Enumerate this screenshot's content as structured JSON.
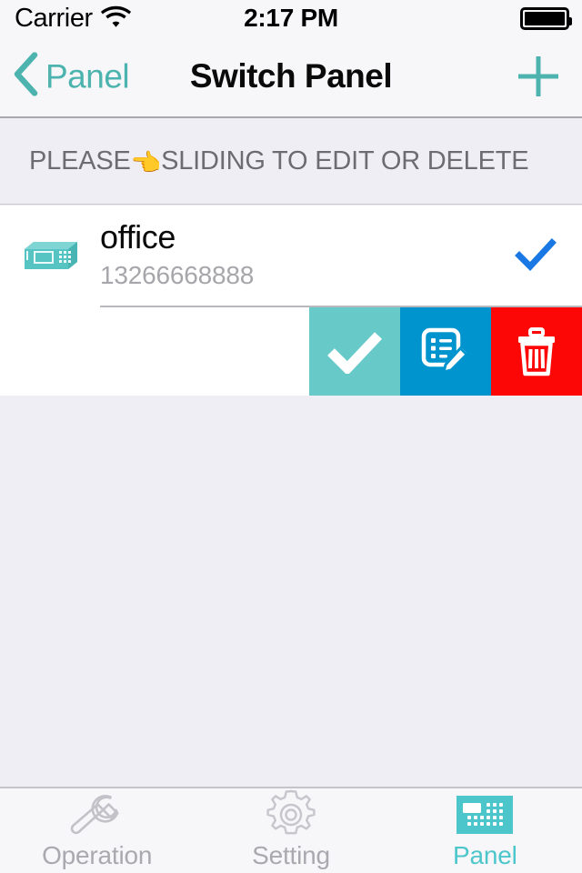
{
  "status_bar": {
    "carrier": "Carrier",
    "wifi_icon": "wifi-icon",
    "time": "2:17 PM",
    "battery_icon": "battery-full-icon"
  },
  "nav_bar": {
    "back_label": "Panel",
    "back_icon": "chevron-left-icon",
    "title": "Switch Panel",
    "add_icon": "plus-icon",
    "tint_color": "#4cb3ae"
  },
  "section": {
    "header_prefix": "PLEASE",
    "header_emoji": "👈",
    "header_suffix": "SLIDING TO EDIT OR DELETE"
  },
  "list": {
    "rows": [
      {
        "device_icon": "switch-panel-device-icon",
        "title": "office",
        "subtitle": "13266668888",
        "selected_icon": "checkmark-icon",
        "selected_color": "#1a78e5",
        "swipe_actions": [
          {
            "name": "confirm",
            "icon": "checkmark-icon",
            "color": "#68c9c9"
          },
          {
            "name": "edit",
            "icon": "edit-note-pencil-icon",
            "color": "#0094ce"
          },
          {
            "name": "delete",
            "icon": "trash-icon",
            "color": "#fc0606"
          }
        ]
      }
    ]
  },
  "tab_bar": {
    "tabs": [
      {
        "label": "Operation",
        "icon": "wrench-icon",
        "active": false
      },
      {
        "label": "Setting",
        "icon": "gear-icon",
        "active": false
      },
      {
        "label": "Panel",
        "icon": "keypad-panel-icon",
        "active": true
      }
    ],
    "active_color": "#4cc6cb",
    "inactive_color": "#a9a9af"
  }
}
